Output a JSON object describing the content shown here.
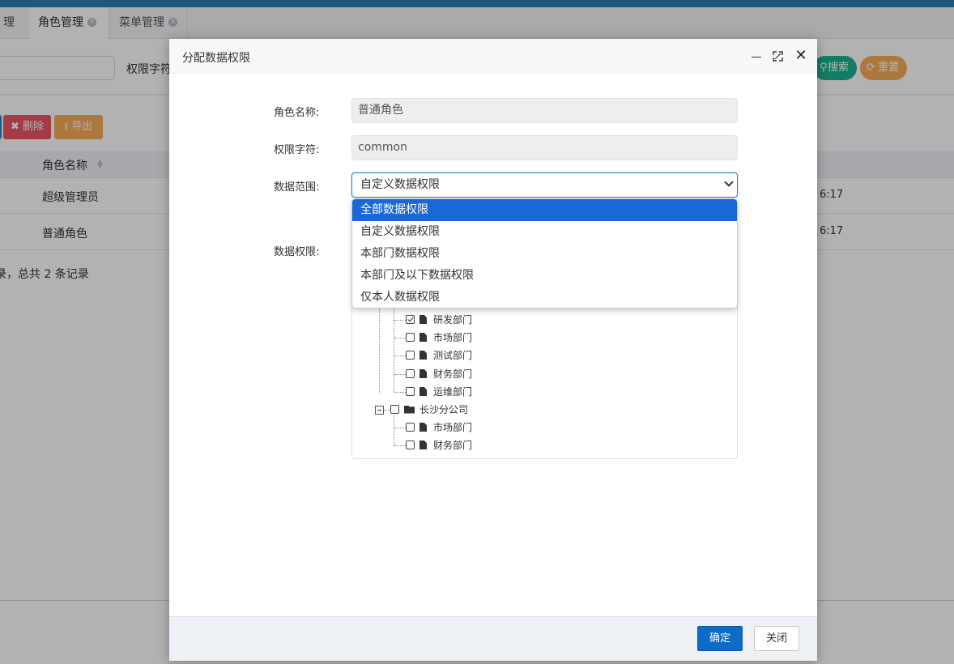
{
  "tabs": [
    {
      "label": "理",
      "close": "×"
    },
    {
      "label": "角色管理",
      "close": "×"
    },
    {
      "label": "菜单管理",
      "close": "×"
    }
  ],
  "search": {
    "label": "权限字符",
    "search_button": "搜索",
    "reset_button": "重置"
  },
  "toolbar": {
    "delete_label": "删除",
    "export_label": "导出"
  },
  "table": {
    "column_header": "角色名称",
    "rows": [
      {
        "name": "超级管理员",
        "time": "6:17"
      },
      {
        "name": "普通角色",
        "time": "6:17"
      }
    ],
    "footer": "录，总共 2 条记录"
  },
  "modal": {
    "title": "分配数据权限",
    "role_name_label": "角色名称:",
    "role_name_value": "普通角色",
    "perm_key_label": "权限字符:",
    "perm_key_value": "common",
    "scope_label": "数据范围:",
    "scope_selected": "自定义数据权限",
    "scope_options": [
      "全部数据权限",
      "自定义数据权限",
      "本部门数据权限",
      "本部门及以下数据权限",
      "仅本人数据权限"
    ],
    "data_perm_label": "数据权限:",
    "tree": [
      {
        "label": "研发部门",
        "checked": true
      },
      {
        "label": "市场部门",
        "checked": false
      },
      {
        "label": "测试部门",
        "checked": false
      },
      {
        "label": "财务部门",
        "checked": false
      },
      {
        "label": "运维部门",
        "checked": false
      },
      {
        "label": "长沙分公司",
        "checked": false
      },
      {
        "label": "市场部门",
        "checked": false
      },
      {
        "label": "财务部门",
        "checked": false
      }
    ],
    "ok_button": "确定",
    "cancel_button": "关闭"
  }
}
